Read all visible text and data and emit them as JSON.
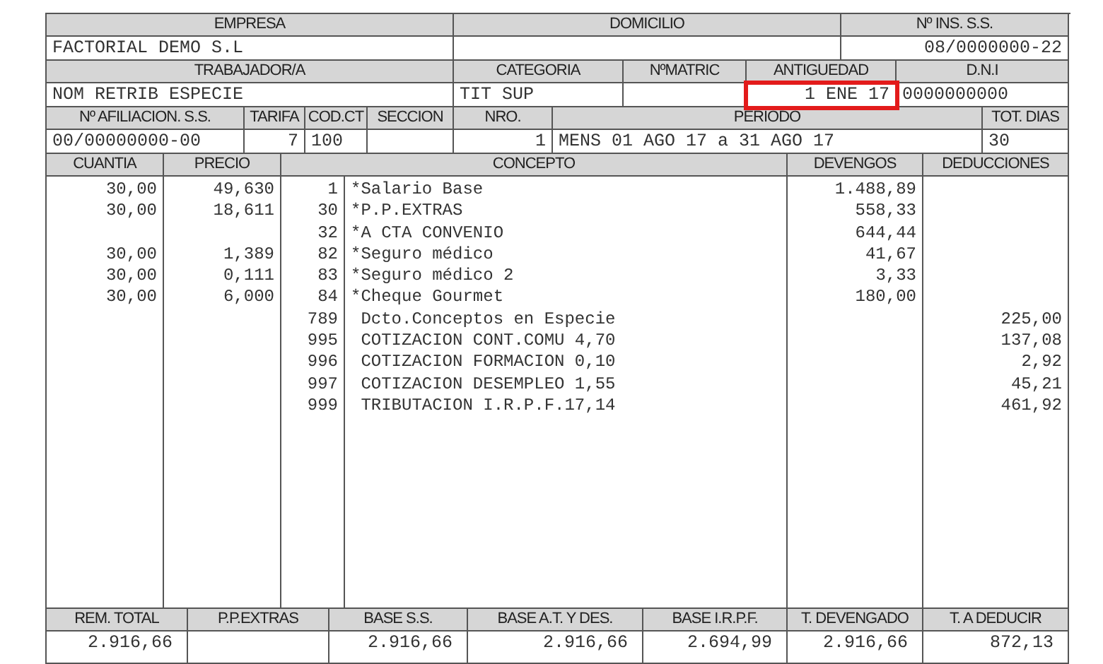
{
  "top_block": [
    {
      "cells": [
        {
          "label": "EMPRESA",
          "value": "FACTORIAL DEMO S.L"
        },
        {
          "label": "DOMICILIO"
        },
        {
          "label": "Nº INS. S.S.",
          "value": "08/0000000-22"
        }
      ]
    },
    {
      "cells": [
        {
          "label": "TRABAJADOR/A",
          "value": "NOM RETRIB ESPECIE"
        },
        {
          "label": "CATEGORIA",
          "value": "TIT SUP"
        },
        {
          "label": "NºMATRIC"
        },
        {
          "label": "ANTIGUEDAD",
          "value": "1 ENE 17",
          "highlighted": true
        },
        {
          "label": "D.N.I",
          "value": "0000000000",
          "highlighted": false
        }
      ]
    },
    {
      "cells": [
        {
          "label": "Nº AFILIACION. S.S.",
          "value": "00/00000000-00"
        },
        {
          "label": "TARIFA",
          "value": "7"
        },
        {
          "label": "COD.CT",
          "value": "100"
        },
        {
          "label": "SECCION"
        },
        {
          "label": "NRO.",
          "value": "1"
        },
        {
          "label": "PERIODO",
          "value": "MENS 01 AGO 17 a 31 AGO 17"
        },
        {
          "label": "TOT. DIAS",
          "value": "30"
        }
      ]
    }
  ],
  "lines_table": {
    "columns": [
      "CUANTIA",
      "PRECIO",
      "CONCEPTO",
      "DEVENGOS",
      "DEDUCCIONES"
    ],
    "rows": [
      {
        "cuantia": "30,00",
        "precio": "49,630",
        "code": "1",
        "concept": "*Salario Base",
        "devengos": "1.488,89"
      },
      {
        "cuantia": "30,00",
        "precio": "18,611",
        "code": "30",
        "concept": "*P.P.EXTRAS",
        "devengos": "558,33"
      },
      {
        "code": "32",
        "concept": "*A CTA CONVENIO",
        "devengos": "644,44"
      },
      {
        "cuantia": "30,00",
        "precio": "1,389",
        "code": "82",
        "concept": "*Seguro médico",
        "devengos": "41,67"
      },
      {
        "cuantia": "30,00",
        "precio": "0,111",
        "code": "83",
        "concept": "*Seguro médico 2",
        "devengos": "3,33"
      },
      {
        "cuantia": "30,00",
        "precio": "6,000",
        "code": "84",
        "concept": "*Cheque Gourmet",
        "devengos": "180,00"
      },
      {
        "code": "789",
        "concept": " Dcto.Conceptos en Especie",
        "deducciones": "225,00"
      },
      {
        "code": "995",
        "concept": " COTIZACION CONT.COMU 4,70",
        "deducciones": "137,08"
      },
      {
        "code": "996",
        "concept": " COTIZACION FORMACION 0,10",
        "deducciones": "2,92"
      },
      {
        "code": "997",
        "concept": " COTIZACION DESEMPLEO 1,55",
        "deducciones": "45,21"
      },
      {
        "code": "999",
        "concept": " TRIBUTACION I.R.P.F.17,14",
        "deducciones": "461,92"
      }
    ]
  },
  "totals": [
    {
      "label": "REM. TOTAL",
      "value": "2.916,66"
    },
    {
      "label": "P.P.EXTRAS"
    },
    {
      "label": "BASE S.S.",
      "value": "2.916,66"
    },
    {
      "label": "BASE A.T. Y DES.",
      "value": "2.916,66"
    },
    {
      "label": "BASE I.R.P.F.",
      "value": "2.694,99"
    },
    {
      "label": "T. DEVENGADO",
      "value": "2.916,66"
    },
    {
      "label": "T. A DEDUCIR",
      "value": "872,13"
    }
  ]
}
